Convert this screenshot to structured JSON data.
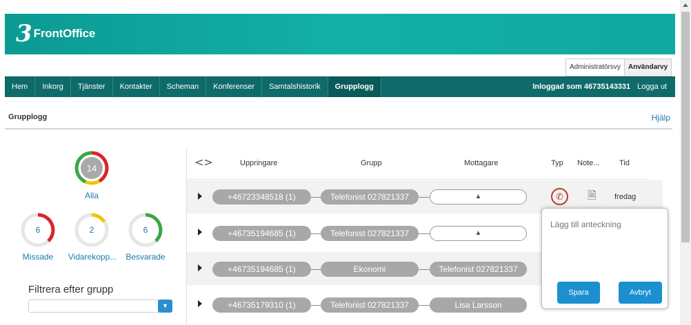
{
  "brand": {
    "name": "FrontOffice",
    "logo_glyph": "3"
  },
  "view_toggle": {
    "admin": "Administratörsvy",
    "user": "Användarvy"
  },
  "nav": {
    "items": [
      "Hem",
      "Inkorg",
      "Tjänster",
      "Kontakter",
      "Scheman",
      "Konferenser",
      "Samtalshistorik",
      "Grupplogg"
    ],
    "active": "Grupplogg",
    "logged_in": "Inloggad som 46735143331",
    "logout": "Logga ut"
  },
  "page": {
    "title": "Grupplogg",
    "help": "Hjälp"
  },
  "stats": {
    "all": {
      "value": "14",
      "label": "Alla"
    },
    "missed": {
      "value": "6",
      "label": "Missade"
    },
    "forwarded": {
      "value": "2",
      "label": "Vidarekopp..."
    },
    "answered": {
      "value": "6",
      "label": "Besvarade"
    },
    "colors": {
      "missed": "#d9262b",
      "forwarded": "#f2c400",
      "answered": "#3aa745",
      "track": "#e6e6e6"
    }
  },
  "filter": {
    "label": "Filtrera efter grupp",
    "value": ""
  },
  "table": {
    "headers": {
      "caller": "Uppringare",
      "group": "Grupp",
      "receiver": "Mottagare",
      "type": "Typ",
      "note": "Note...",
      "time": "Tid"
    },
    "rows": [
      {
        "caller": "+46723348518 (1)",
        "group": "Telefonist 027821337",
        "receiver": "",
        "receiver_icon": "arrow-up-icon",
        "time": "fredag"
      },
      {
        "caller": "+46735194685 (1)",
        "group": "Telefonist 027821337",
        "receiver": "",
        "receiver_icon": "arrow-up-icon",
        "time": ""
      },
      {
        "caller": "+46735194685 (1)",
        "group": "Ekonomi",
        "receiver": "Telefonist 027821337",
        "time": ""
      },
      {
        "caller": "+46735179310 (1)",
        "group": "Telefonist 027821337",
        "receiver": "Lisa Larsson",
        "time": ""
      }
    ]
  },
  "note_popup": {
    "placeholder": "Lägg till anteckning",
    "save": "Spara",
    "cancel": "Avbryt"
  }
}
